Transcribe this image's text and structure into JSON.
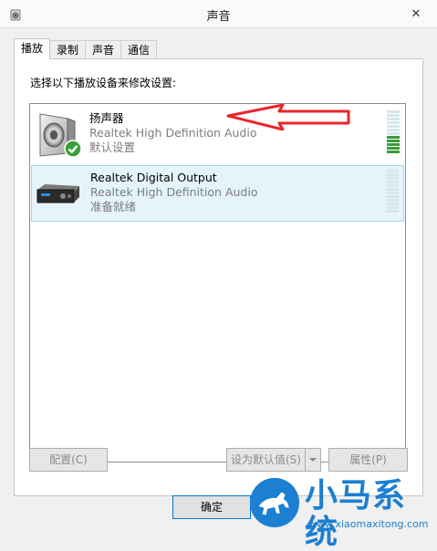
{
  "window": {
    "title": "声音",
    "close_glyph": "✕"
  },
  "tabs": [
    {
      "label": "播放",
      "active": true
    },
    {
      "label": "录制",
      "active": false
    },
    {
      "label": "声音",
      "active": false
    },
    {
      "label": "通信",
      "active": false
    }
  ],
  "panel": {
    "instruction": "选择以下播放设备来修改设置:"
  },
  "devices": [
    {
      "name": "扬声器",
      "driver": "Realtek High Definition Audio",
      "status": "默认设置",
      "icon": "speaker-icon",
      "default": true,
      "level_on_segments": 5,
      "level_total_segments": 12
    },
    {
      "name": "Realtek Digital Output",
      "driver": "Realtek High Definition Audio",
      "status": "准备就绪",
      "icon": "digital-output-icon",
      "default": false,
      "level_on_segments": 0,
      "level_total_segments": 12
    }
  ],
  "buttons": {
    "configure": "配置(C)",
    "set_default": "设为默认值(S)",
    "properties": "属性(P)",
    "ok": "确定"
  },
  "watermark": {
    "brand": "小马系统",
    "url": "www.xiaomaxitong.com"
  },
  "colors": {
    "accent": "#0078d7",
    "arrow": "#e8262b",
    "selection": "#e5f3fb",
    "meter_on": "#3a9a3a",
    "watermark_blue": "#1c7fd1"
  }
}
